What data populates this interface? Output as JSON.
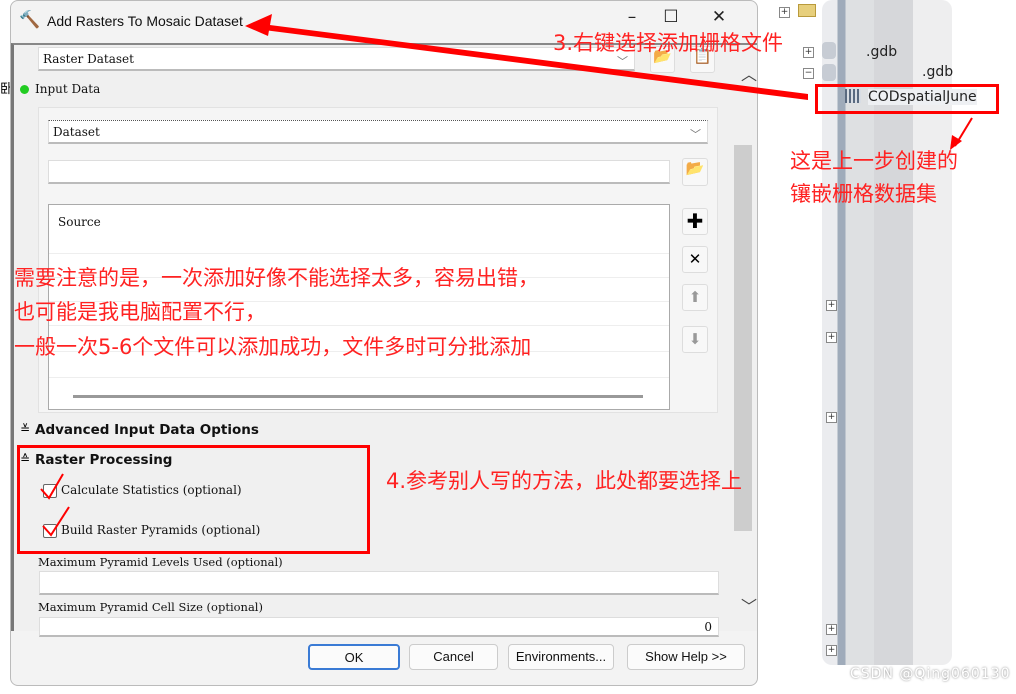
{
  "window": {
    "title": "Add Rasters To Mosaic Dataset",
    "minimize": "–",
    "maximize": "☐",
    "close": "✕"
  },
  "form": {
    "raster_type": "Raster Dataset",
    "input_data_label": "Input Data",
    "input_type": "Dataset",
    "path_value": "",
    "source_header": "Source",
    "advanced_label": "Advanced Input Data Options",
    "raster_processing_label": "Raster Processing",
    "calc_stats_label": "Calculate Statistics (optional)",
    "build_pyramids_label": "Build Raster Pyramids (optional)",
    "max_levels_label": "Maximum Pyramid Levels Used (optional)",
    "max_levels_value": "",
    "max_cell_label": "Maximum Pyramid Cell Size (optional)",
    "max_cell_value": "0",
    "status_dot_color": "#22cc22"
  },
  "buttons": {
    "ok": "OK",
    "cancel": "Cancel",
    "environments": "Environments...",
    "show_help": "Show Help >>"
  },
  "tree": {
    "items": [
      {
        "label": ".gdb"
      },
      {
        "label": ".gdb"
      },
      {
        "label": "CODspatialJune"
      }
    ]
  },
  "annotations": {
    "step3": "3.右键选择添加栅格文件",
    "created_line1": "这是上一步创建的",
    "created_line2": "镶嵌栅格数据集",
    "note_line1": "需要注意的是，一次添加好像不能选择太多，容易出错，",
    "note_line2": "也可能是我电脑配置不行，",
    "note_line3": "一般一次5-6个文件可以添加成功，文件多时可分批添加",
    "step4": "4.参考别人写的方法，此处都要选择上",
    "color": "#ff0000"
  },
  "watermark": "CSDN @Qing060130"
}
